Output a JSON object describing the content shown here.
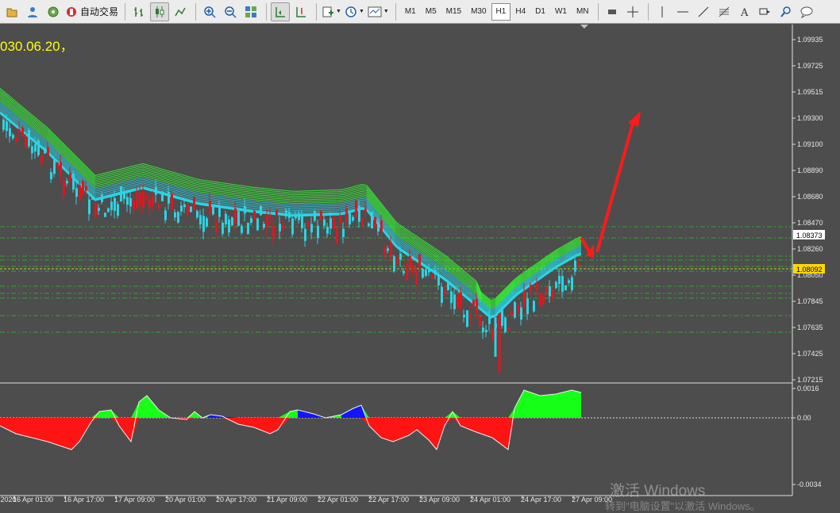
{
  "toolbar": {
    "autotrade_label": "自动交易",
    "timeframes": [
      "M1",
      "M5",
      "M15",
      "M30",
      "H1",
      "H4",
      "D1",
      "W1",
      "MN"
    ],
    "active_timeframe": "H1"
  },
  "chart": {
    "overlay_text": "030.06.20，",
    "price_axis": [
      "1.09935",
      "1.09725",
      "1.09515",
      "1.09300",
      "1.09100",
      "1.08890",
      "1.08680",
      "1.08470",
      "1.08260",
      "1.08050",
      "1.07845",
      "1.07635",
      "1.07425",
      "1.07215"
    ],
    "price_tag_current": "1.08373",
    "price_tag_line": "1.08092",
    "indicator_axis": [
      "0.0016",
      "0.00",
      "-0.0034"
    ],
    "time_axis": [
      "16 Apr 2020",
      "16 Apr 01:00",
      "16 Apr 17:00",
      "17 Apr 09:00",
      "20 Apr 01:00",
      "20 Apr 17:00",
      "21 Apr 09:00",
      "22 Apr 01:00",
      "22 Apr 17:00",
      "23 Apr 09:00",
      "24 Apr 01:00",
      "24 Apr 17:00",
      "27 Apr 09:00"
    ],
    "colors": {
      "background": "#4d4d4d",
      "bull_candle": "#e0161e",
      "bear_candle": "#2ad4e6",
      "ribbon_green": "#32ff32",
      "ribbon_blue": "#2ad4e6",
      "level_line": "#2ea52e",
      "arrow": "#ff1a1a",
      "histogram_pos": "#16ff16",
      "histogram_neg": "#ff1414",
      "histogram_blue": "#1414ff",
      "price_tag_bg": "#ffd700"
    }
  },
  "watermark": {
    "line1": "激活 Windows",
    "line2": "转到\"电脑设置\"以激活 Windows。"
  }
}
